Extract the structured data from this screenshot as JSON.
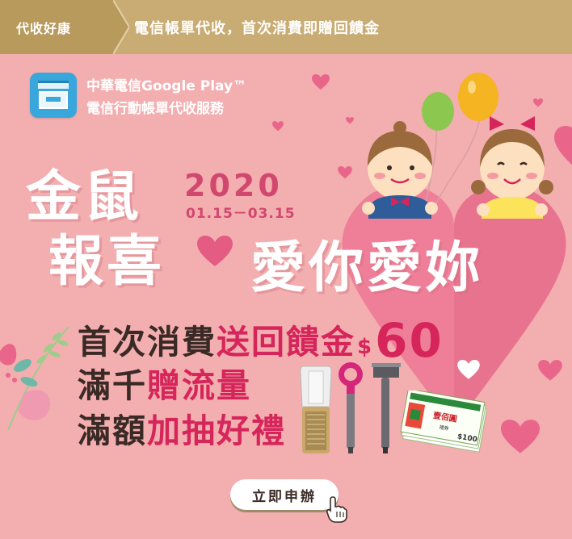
{
  "header": {
    "tab_label": "代收好康",
    "title": "電信帳單代收，首次消費即贈回饋金"
  },
  "app": {
    "icon": "store-icon",
    "line1": "中華電信Google Play™",
    "line2": "電信行動帳單代收服務"
  },
  "headline": {
    "part1": "金鼠",
    "part2": "報喜",
    "part3": "愛你愛妳",
    "year": "2020",
    "dates": "01.15－03.15"
  },
  "promos": {
    "line1_a": "首次消費",
    "line1_b": "送回饋金",
    "line1_dollar": "$",
    "line1_amount": "60",
    "line2_a": "滿千",
    "line2_b": "贈流量",
    "line3_a": "滿額",
    "line3_b": "加抽好禮"
  },
  "products": {
    "voucher_title": "壹佰圓",
    "voucher_sub": "禮券",
    "voucher_value": "$100"
  },
  "cta": {
    "label": "立即申辦"
  },
  "colors": {
    "background": "#f3aeb0",
    "header": "#c9ac74",
    "accent_red": "#d6255a",
    "text_dark": "#3a2a25"
  }
}
